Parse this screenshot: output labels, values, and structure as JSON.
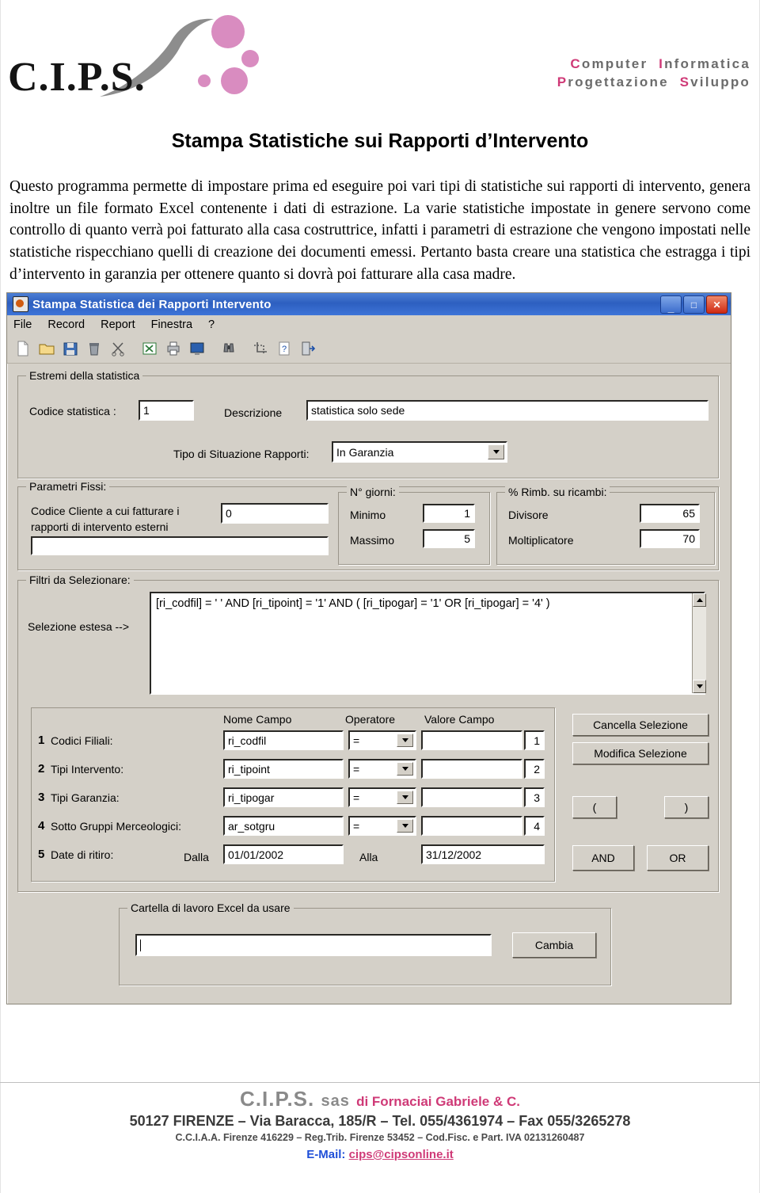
{
  "header": {
    "logo_text": "C.I.P.S.",
    "brand_line1_pink": "C",
    "brand_line1": "omputer",
    "brand_line1b_pink": "I",
    "brand_line1b": "nformatica",
    "brand_line2_pink": "P",
    "brand_line2": "rogettazione",
    "brand_line2b_pink": "S",
    "brand_line2b": "viluppo",
    "brand_full_line1": "C o m p u t e r    I n f o r m a t i c a",
    "brand_full_line2": "P r o g e t t a z i o n e   S v i l u p p o"
  },
  "document": {
    "title": "Stampa Statistiche sui Rapporti d’Intervento",
    "paragraph": "Questo programma permette di impostare prima ed eseguire poi vari tipi di statistiche sui rapporti di intervento, genera inoltre un file formato Excel  contenente i dati di estrazione. La varie statistiche impostate in genere servono come controllo di quanto verrà poi fatturato alla casa costruttrice, infatti i parametri di estrazione che vengono impostati nelle statistiche rispecchiano quelli di creazione dei documenti emessi. Pertanto basta creare una statistica che estragga i tipi d’intervento in garanzia per ottenere quanto si dovrà poi fatturare alla casa madre."
  },
  "app": {
    "title": "Stampa Statistica dei Rapporti Intervento",
    "window_buttons": {
      "minimize": "_",
      "maximize": "□",
      "close": "✕"
    },
    "menu": [
      "File",
      "Record",
      "Report",
      "Finestra",
      "?"
    ],
    "toolbar_icons": [
      "new-document-icon",
      "open-folder-icon",
      "save-disk-icon",
      "delete-trash-icon",
      "cut-scissors-icon",
      "export-excel-icon",
      "print-icon",
      "screen-preview-icon",
      "find-binoculars-icon",
      "crop-icon",
      "help-question-icon",
      "exit-door-icon"
    ],
    "group_estremi": {
      "title": "Estremi della statistica",
      "codice_label": "Codice statistica :",
      "codice_value": "1",
      "descrizione_label": "Descrizione",
      "descrizione_value": "statistica solo sede",
      "tipo_label": "Tipo di Situazione Rapporti:",
      "tipo_value": "In Garanzia"
    },
    "group_parametri": {
      "title": "Parametri Fissi:",
      "cliente_label_line1": "Codice Cliente a cui fatturare i",
      "cliente_label_line2": "rapporti di intervento esterni",
      "cliente_value": "0",
      "cliente_value2": "",
      "giorni_title": "N° giorni:",
      "minimo_label": "Minimo",
      "minimo_value": "1",
      "massimo_label": "Massimo",
      "massimo_value": "5",
      "rimb_title": "% Rimb. su ricambi:",
      "divisore_label": "Divisore",
      "divisore_value": "65",
      "moltiplicatore_label": "Moltiplicatore",
      "moltiplicatore_value": "70"
    },
    "group_filtri": {
      "title": "Filtri da Selezionare:",
      "selezione_label": "Selezione estesa -->",
      "expression": "[ri_codfil] = ' ' AND  [ri_tipoint] = '1' AND  (  [ri_tipogar] = '1' OR  [ri_tipogar] = '4' )",
      "col_headers": [
        "Nome Campo",
        "Operatore",
        "Valore Campo"
      ],
      "rows": [
        {
          "num": "1",
          "label": "Codici Filiali:",
          "field": "ri_codfil",
          "operator": "=",
          "value": "",
          "index": "1"
        },
        {
          "num": "2",
          "label": "Tipi Intervento:",
          "field": "ri_tipoint",
          "operator": "=",
          "value": "",
          "index": "2"
        },
        {
          "num": "3",
          "label": "Tipi Garanzia:",
          "field": "ri_tipogar",
          "operator": "=",
          "value": "",
          "index": "3"
        },
        {
          "num": "4",
          "label": "Sotto Gruppi Merceologici:",
          "field": "ar_sotgru",
          "operator": "=",
          "value": "",
          "index": "4"
        }
      ],
      "date_row": {
        "num": "5",
        "label": "Date di ritiro:",
        "dalla_label": "Dalla",
        "dalla_value": "01/01/2002",
        "alla_label": "Alla",
        "alla_value": "31/12/2002"
      },
      "buttons": {
        "cancella": "Cancella Selezione",
        "modifica": "Modifica Selezione",
        "paren_open": "(",
        "paren_close": ")",
        "and": "AND",
        "or": "OR"
      }
    },
    "group_excel": {
      "title": "Cartella di lavoro Excel da usare",
      "path_value": "",
      "cambia_button": "Cambia"
    }
  },
  "footer": {
    "company": "C.I.P.S.",
    "sas": "sas",
    "owner": "di Fornaciai Gabriele & C.",
    "address": "50127 FIRENZE – Via Baracca, 185/R – Tel. 055/4361974 – Fax 055/3265278",
    "legal": "C.C.I.A.A. Firenze 416229 – Reg.Trib. Firenze 53452 – Cod.Fisc. e Part. IVA 02131260487",
    "email_label": "E-Mail: ",
    "email": "cips@cipsonline.it"
  }
}
